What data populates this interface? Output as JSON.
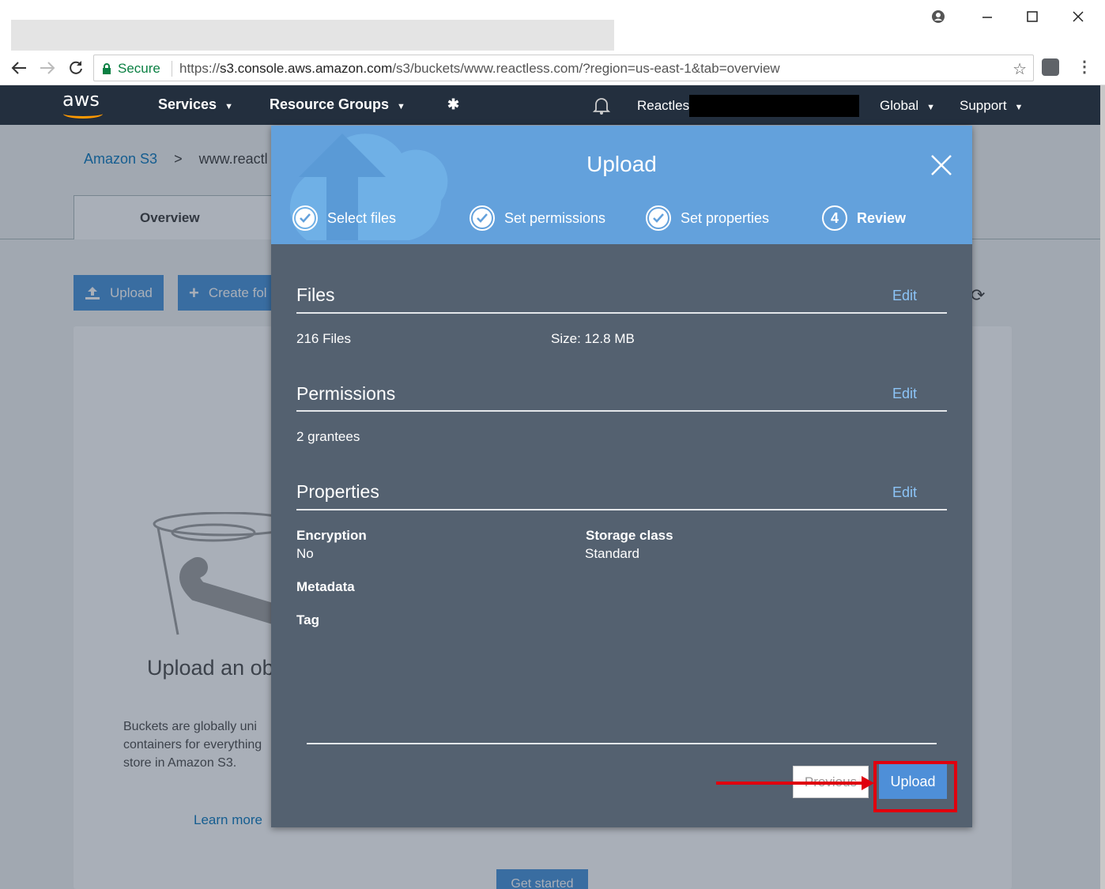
{
  "browser": {
    "secure_label": "Secure",
    "url_prefix": "https://",
    "url_domain": "s3.console.aws.amazon.com",
    "url_path": "/s3/buckets/www.reactless.com/?region=us-east-1&tab=overview"
  },
  "awsnav": {
    "logo": "aws",
    "services": "Services",
    "resource_groups": "Resource Groups",
    "account": "Reactless",
    "region": "Global",
    "support": "Support"
  },
  "page": {
    "breadcrumb": {
      "root": "Amazon S3",
      "separator": ">",
      "current": "www.reactl"
    },
    "tab_overview": "Overview",
    "upload_btn": "Upload",
    "create_folder_btn": "Create fol",
    "empty_title": "Upload an ob",
    "empty_desc": "Buckets are globally uni containers for everything store in Amazon S3.",
    "learn_more": "Learn more",
    "get_started": "Get started"
  },
  "modal": {
    "title": "Upload",
    "steps": [
      {
        "label": "Select files",
        "state": "done"
      },
      {
        "label": "Set permissions",
        "state": "done"
      },
      {
        "label": "Set properties",
        "state": "done"
      },
      {
        "label": "Review",
        "number": "4",
        "state": "active"
      }
    ],
    "files": {
      "title": "Files",
      "edit": "Edit",
      "count": "216 Files",
      "size": "Size: 12.8 MB"
    },
    "permissions": {
      "title": "Permissions",
      "edit": "Edit",
      "grantees": "2 grantees"
    },
    "properties": {
      "title": "Properties",
      "edit": "Edit",
      "encryption_label": "Encryption",
      "encryption_value": "No",
      "storage_label": "Storage class",
      "storage_value": "Standard",
      "metadata_label": "Metadata",
      "tag_label": "Tag"
    },
    "previous_btn": "Previous",
    "upload_btn": "Upload"
  },
  "colors": {
    "aws_nav": "#232f3e",
    "modal_header": "#63a1dc",
    "modal_body": "#546170",
    "primary_button": "#4e8fd8",
    "annotation": "#e0000e"
  }
}
